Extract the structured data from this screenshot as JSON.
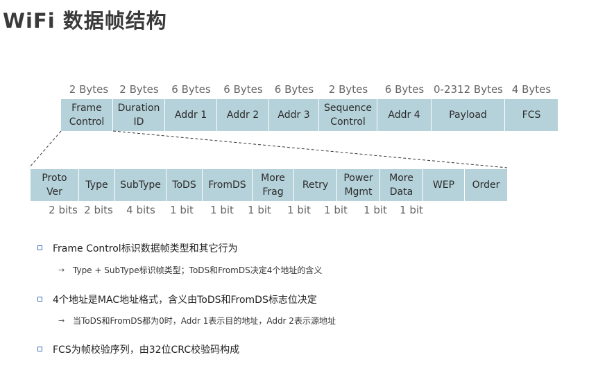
{
  "title": "WiFi 数据帧结构",
  "frame": {
    "fields": [
      {
        "label": "Frame\nControl",
        "size": "2 Bytes"
      },
      {
        "label": "Duration\nID",
        "size": "2 Bytes"
      },
      {
        "label": "Addr 1",
        "size": "6 Bytes"
      },
      {
        "label": "Addr 2",
        "size": "6 Bytes"
      },
      {
        "label": "Addr 3",
        "size": "6 Bytes"
      },
      {
        "label": "Sequence\nControl",
        "size": "2 Bytes"
      },
      {
        "label": "Addr 4",
        "size": "6 Bytes"
      },
      {
        "label": "Payload",
        "size": "0-2312 Bytes"
      },
      {
        "label": "FCS",
        "size": "4 Bytes"
      }
    ]
  },
  "control": {
    "fields": [
      {
        "label": "Proto\nVer",
        "size": "2 bits"
      },
      {
        "label": "Type",
        "size": "2 bits"
      },
      {
        "label": "SubType",
        "size": "4 bits"
      },
      {
        "label": "ToDS",
        "size": "1 bit"
      },
      {
        "label": "FromDS",
        "size": "1 bit"
      },
      {
        "label": "More\nFrag",
        "size": "1 bit"
      },
      {
        "label": "Retry",
        "size": "1 bit"
      },
      {
        "label": "Power\nMgmt",
        "size": "1 bit"
      },
      {
        "label": "More\nData",
        "size": "1 bit"
      },
      {
        "label": "WEP",
        "size": "1 bit"
      },
      {
        "label": "Order",
        "size": ""
      }
    ]
  },
  "bullets": [
    {
      "text": "Frame Control标识数据帧类型和其它行为",
      "sub": "Type + SubType标识帧类型；ToDS和FromDS决定4个地址的含义"
    },
    {
      "text": "4个地址是MAC地址格式，含义由ToDS和FromDS标志位决定",
      "sub": "当ToDS和FromDS都为0时，Addr 1表示目的地址，Addr 2表示源地址"
    },
    {
      "text": "FCS为帧校验序列，由32位CRC校验码构成",
      "sub": ""
    }
  ],
  "bullet_marker_color": "#3a6fb6",
  "cell_color": "#b5d1d9",
  "arrow_glyph": "→"
}
